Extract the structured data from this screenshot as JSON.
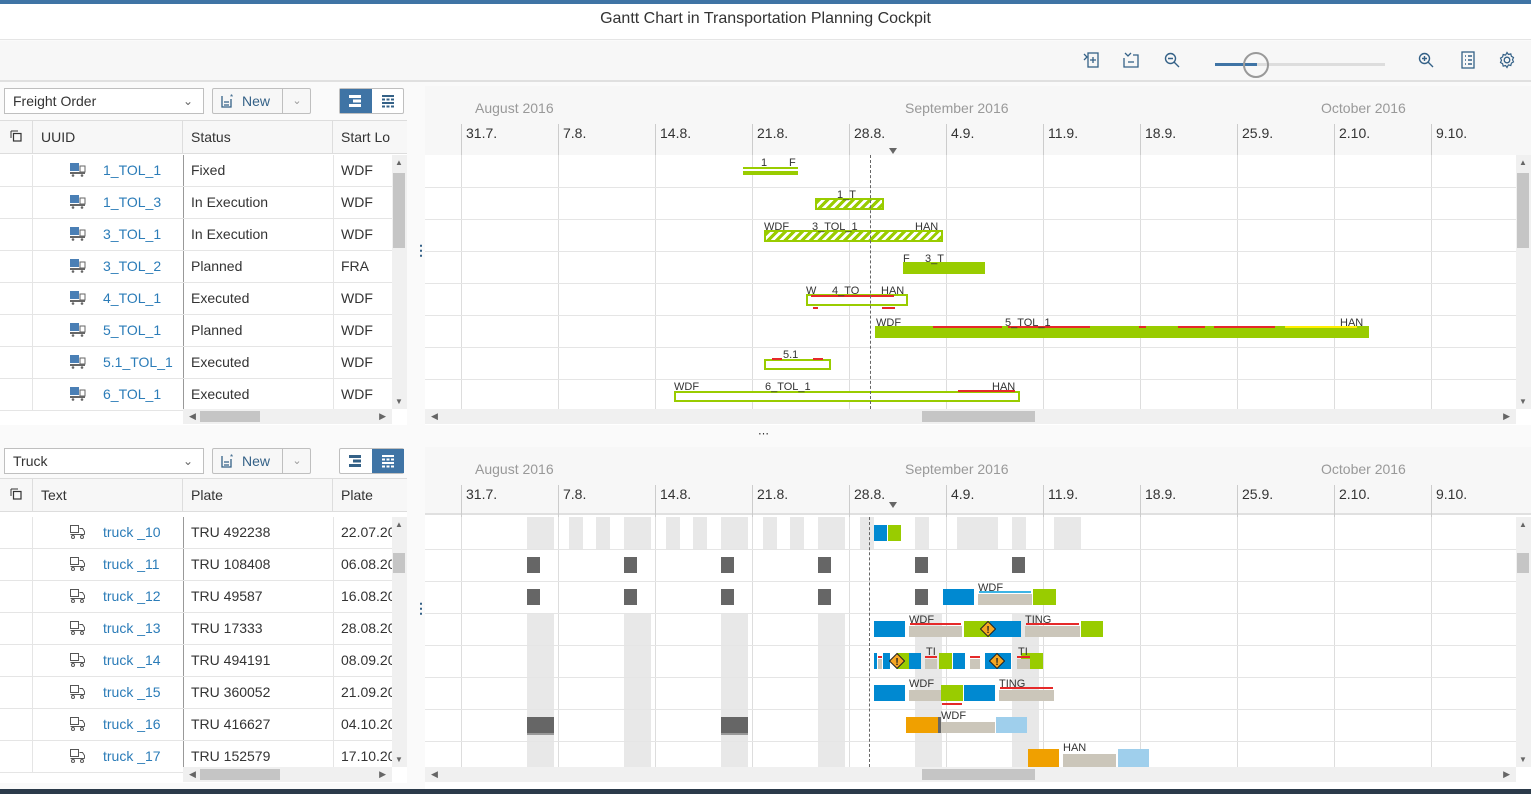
{
  "app": {
    "title": "Gantt Chart in Transportation Planning Cockpit"
  },
  "toolbar": {
    "icons": [
      "expand-icon",
      "collapse-icon",
      "zoom-out-icon",
      "zoom-in-icon",
      "legend-icon",
      "settings-icon"
    ],
    "zoom_slider_value": 0.25
  },
  "upper": {
    "selector": {
      "value": "Freight Order"
    },
    "new_button": {
      "label": "New"
    },
    "view_toggle": {
      "active": "gantt"
    },
    "columns": [
      "UUID",
      "Status",
      "Start Lo"
    ],
    "rows": [
      {
        "uuid": "1_TOL_1",
        "status": "Fixed",
        "start": "WDF"
      },
      {
        "uuid": "1_TOL_3",
        "status": "In Execution",
        "start": "WDF"
      },
      {
        "uuid": "3_TOL_1",
        "status": "In Execution",
        "start": "WDF"
      },
      {
        "uuid": "3_TOL_2",
        "status": "Planned",
        "start": "FRA"
      },
      {
        "uuid": "4_TOL_1",
        "status": "Executed",
        "start": "WDF"
      },
      {
        "uuid": "5_TOL_1",
        "status": "Planned",
        "start": "WDF"
      },
      {
        "uuid": "5.1_TOL_1",
        "status": "Executed",
        "start": "WDF"
      },
      {
        "uuid": "6_TOL_1",
        "status": "Executed",
        "start": "WDF"
      }
    ]
  },
  "lower": {
    "selector": {
      "value": "Truck"
    },
    "new_button": {
      "label": "New"
    },
    "view_toggle": {
      "active": "utilization"
    },
    "columns": [
      "Text",
      "Plate",
      "Plate Ex"
    ],
    "rows": [
      {
        "text": "truck _10",
        "plate": "TRU 492238",
        "plate_exp": "22.07.20"
      },
      {
        "text": "truck _11",
        "plate": "TRU 108408",
        "plate_exp": "06.08.20"
      },
      {
        "text": "truck _12",
        "plate": "TRU 49587",
        "plate_exp": "16.08.20"
      },
      {
        "text": "truck _13",
        "plate": "TRU 17333",
        "plate_exp": "28.08.20"
      },
      {
        "text": "truck _14",
        "plate": "TRU 494191",
        "plate_exp": "08.09.20"
      },
      {
        "text": "truck _15",
        "plate": "TRU 360052",
        "plate_exp": "21.09.20"
      },
      {
        "text": "truck _16",
        "plate": "TRU 416627",
        "plate_exp": "04.10.20"
      },
      {
        "text": "truck _17",
        "plate": "TRU 152579",
        "plate_exp": "17.10.20"
      }
    ]
  },
  "timeline": {
    "months": [
      "August 2016",
      "September 2016",
      "October 2016"
    ],
    "weeks": [
      "31.7.",
      "7.8.",
      "14.8.",
      "21.8.",
      "28.8.",
      "4.9.",
      "11.9.",
      "18.9.",
      "25.9.",
      "2.10.",
      "9.10."
    ],
    "today": "30.8."
  },
  "colors": {
    "brand": "#3f74a5",
    "link": "#2b7cb8",
    "green": "#99cc00",
    "red": "#e52929",
    "blue": "#0089d1",
    "gray_block": "#666666",
    "beige": "#cbc6ba",
    "orange": "#f0a000",
    "light_blue": "#9fcfec"
  },
  "upper_bars_labels": [
    [
      "1",
      "F"
    ],
    [
      "1_T"
    ],
    [
      "WDF",
      "3_TOL_1",
      "HAN"
    ],
    [
      "F",
      "3_T"
    ],
    [
      "W",
      "4_TO",
      "HAN"
    ],
    [
      "WDF",
      "5_TOL_1",
      "HAN"
    ],
    [
      "5.1"
    ],
    [
      "WDF",
      "6_TOL_1",
      "HAN"
    ]
  ],
  "lower_bars_labels": {
    "r12": "WDF",
    "r13a": "WDF",
    "r13b": "TING",
    "r14a": "TI",
    "r14b": "TI",
    "r15a": "WDF",
    "r15b": "TING",
    "r16": "WDF",
    "r17": "HAN"
  }
}
